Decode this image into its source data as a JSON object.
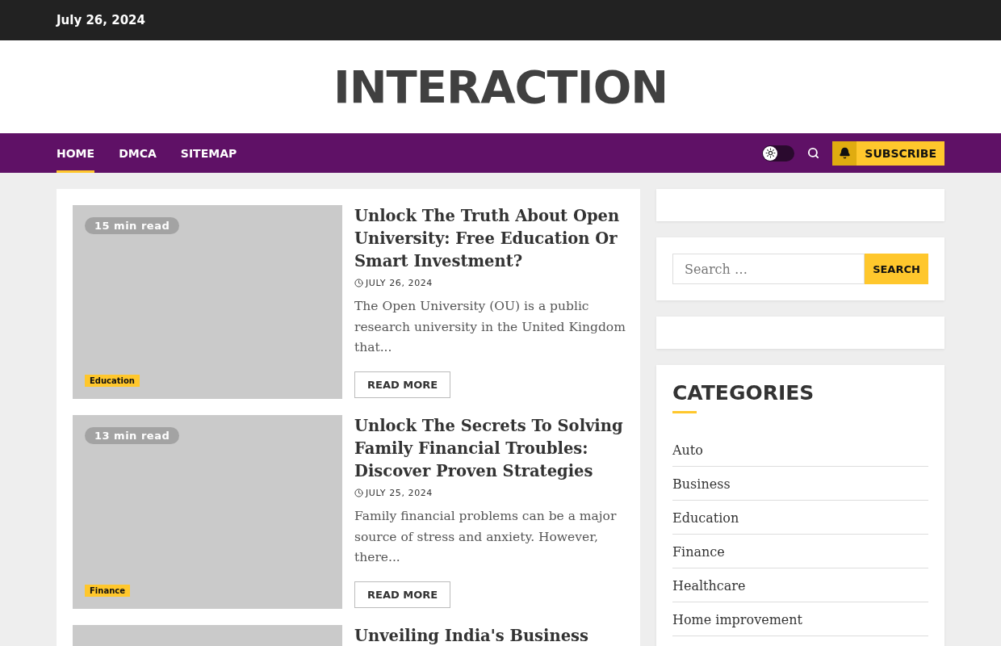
{
  "top_bar": {
    "date": "July 26, 2024"
  },
  "header": {
    "site_title": "INTERACTION"
  },
  "nav": {
    "items": [
      {
        "label": "HOME",
        "selected": true
      },
      {
        "label": "DMCA",
        "selected": false
      },
      {
        "label": "SITEMAP",
        "selected": false
      }
    ],
    "dark_mode": {
      "on": false
    },
    "subscribe": "SUBSCRIBE"
  },
  "articles": [
    {
      "read_time": "15 min read",
      "category": "Education",
      "title": "Unlock The Truth About Open University: Free Education Or Smart Investment?",
      "date": "JULY 26, 2024",
      "excerpt": "The Open University (OU) is a public research university in the United Kingdom that...",
      "button": "READ MORE"
    },
    {
      "read_time": "13 min read",
      "category": "Finance",
      "title": "Unlock The Secrets To Solving Family Financial Troubles: Discover Proven Strategies",
      "date": "JULY 25, 2024",
      "excerpt": "Family financial problems can be a major source of stress and anxiety. However, there...",
      "button": "READ MORE"
    },
    {
      "title": "Unveiling India's Business"
    }
  ],
  "sidebar": {
    "search": {
      "placeholder": "Search …",
      "button": "SEARCH"
    },
    "categories": {
      "title": "CATEGORIES",
      "items": [
        "Auto",
        "Business",
        "Education",
        "Finance",
        "Healthcare",
        "Home improvement"
      ]
    }
  }
}
